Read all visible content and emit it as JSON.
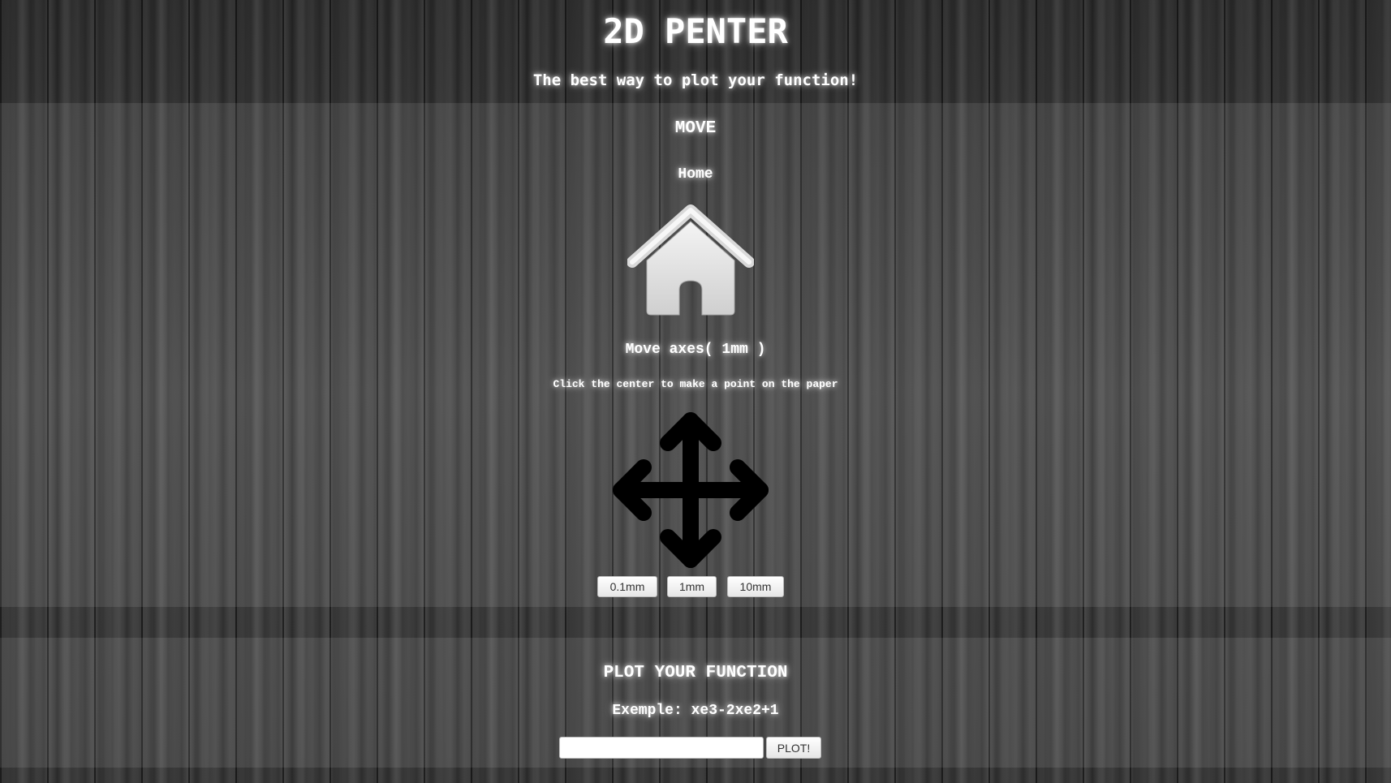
{
  "header": {
    "title": "2D PENTER",
    "subtitle": "The best way to plot your function!"
  },
  "move": {
    "section_title": "MOVE",
    "home_label": "Home",
    "move_axes_label": "Move axes( 1mm )",
    "hint": "Click the center to make a point on the paper",
    "home_icon": "house-icon",
    "move_icon": "four-way-arrows-icon",
    "step_buttons": [
      "0.1mm",
      "1mm",
      "10mm"
    ]
  },
  "plot": {
    "section_title": "PLOT YOUR FUNCTION",
    "example": "Exemple: xe3-2xe2+1",
    "input_value": "",
    "input_placeholder": "",
    "button_label": "PLOT!"
  },
  "colors": {
    "text": "#ffffff",
    "icon_home": "#dcdcdc",
    "icon_arrows": "#000000",
    "button_bg": "#f2f2f2"
  }
}
